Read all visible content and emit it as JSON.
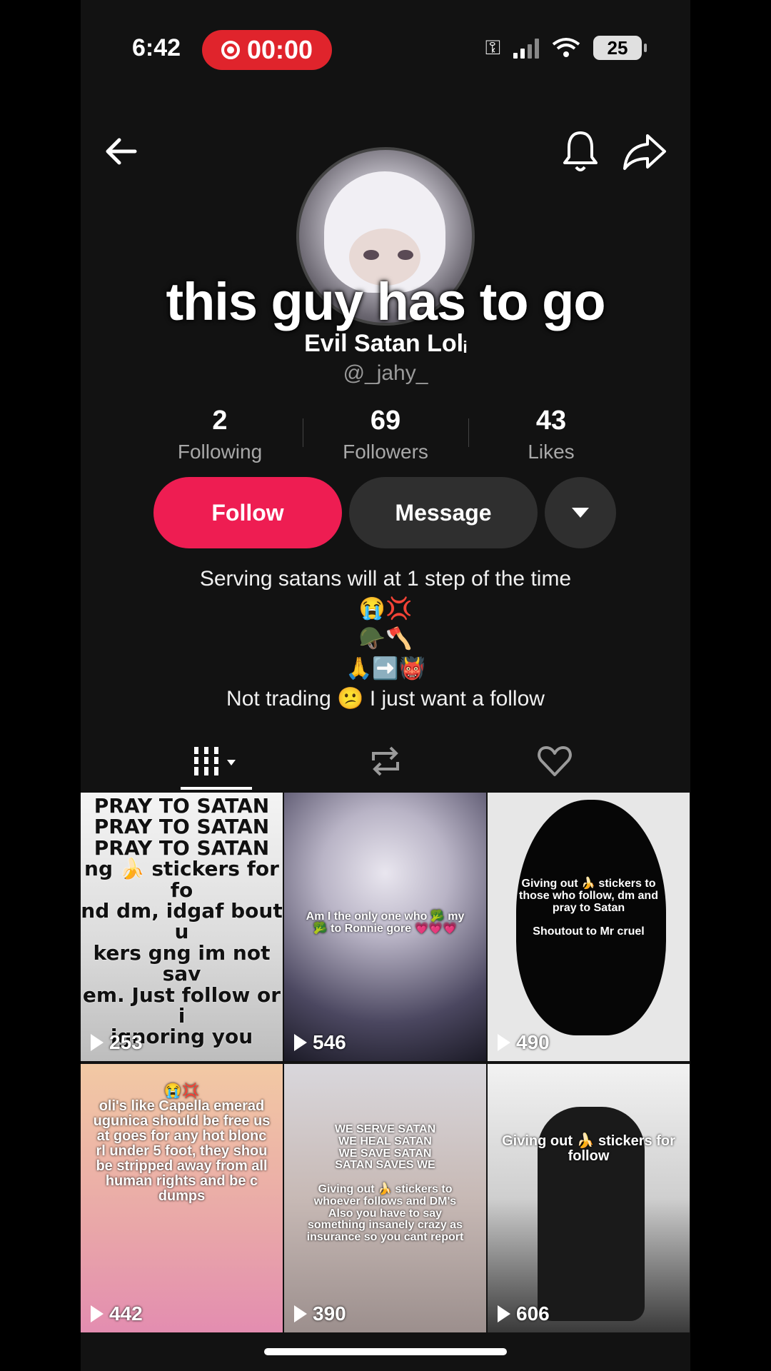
{
  "status_bar": {
    "time": "6:42",
    "recording": "00:00",
    "battery": "25"
  },
  "overlay_caption": "this guy has to go",
  "profile": {
    "display_name": "Evil Satan Lolᵢ",
    "handle": "@_jahy_",
    "stats": [
      {
        "value": "2",
        "label": "Following"
      },
      {
        "value": "69",
        "label": "Followers"
      },
      {
        "value": "43",
        "label": "Likes"
      }
    ],
    "bio_lines": [
      "Serving satans will at 1 step of the time",
      "😭💢",
      "🪖🪓",
      "🙏➡️👹",
      "Not trading 😕 I just want a follow"
    ]
  },
  "buttons": {
    "follow": "Follow",
    "message": "Message"
  },
  "icons": {
    "back": "arrow-left-icon",
    "notifications": "bell-icon",
    "share": "share-arrow-icon",
    "videos_tab": "grid-bars-icon",
    "reposts_tab": "repost-icon",
    "liked_tab": "heart-icon"
  },
  "videos": [
    {
      "views": "253",
      "text": "PRAY TO SATAN\nPRAY TO SATAN\nPRAY TO SATAN\nng 🍌 stickers for fo\nnd dm, idgaf bout u\nkers gng im not sav\nem. Just follow or i\nignoring you"
    },
    {
      "views": "546",
      "text": "Am I the only one who 🥦 my\n🥦 to Ronnie gore 💗💗💗"
    },
    {
      "views": "490",
      "text": "Giving out 🍌 stickers to\nthose who follow, dm and\npray to Satan\n\nShoutout to Mr cruel"
    },
    {
      "views": "442",
      "text": "😭💢\noli's like Capella emerad\nugunica should be free us\nat goes for any hot blonc\nrl under 5 foot, they shou\nbe stripped away from all\nhuman rights and be c\ndumps"
    },
    {
      "views": "390",
      "text": "WE SERVE SATAN\nWE HEAL SATAN\nWE SAVE SATAN\nSATAN SAVES WE\n\nGiving out 🍌 stickers to\nwhoever follows and DM's\nAlso you have to say\nsomething insanely crazy as\ninsurance so you cant report"
    },
    {
      "views": "606",
      "text": "Giving out 🍌 stickers for\nfollow"
    }
  ]
}
